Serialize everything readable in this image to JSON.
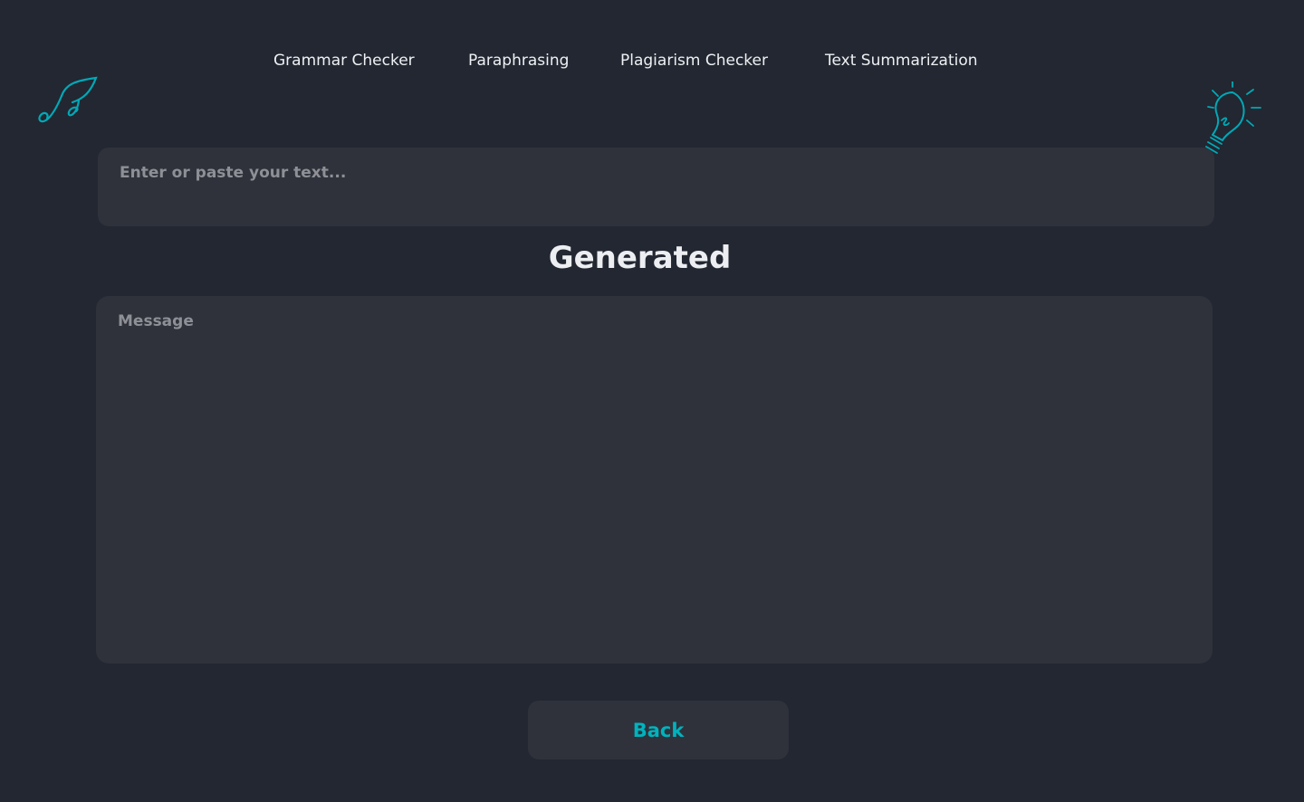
{
  "navigation": {
    "items": [
      {
        "label": "Grammar Checker"
      },
      {
        "label": "Paraphrasing"
      },
      {
        "label": "Plagiarism Checker"
      },
      {
        "label": "Text Summarization"
      }
    ]
  },
  "decorations": {
    "left_icon": "music-note-icon",
    "right_icon": "lightbulb-icon",
    "accent_color": "#00a9b7"
  },
  "input": {
    "placeholder": "Enter or paste your text...",
    "value": ""
  },
  "generated": {
    "heading": "Generated",
    "message_placeholder": "Message",
    "message_value": ""
  },
  "actions": {
    "back_label": "Back"
  },
  "colors": {
    "background": "#222731",
    "panel": "#2f323b",
    "text": "#eceef1",
    "placeholder": "#8e9096",
    "accent": "#00b3bd"
  }
}
